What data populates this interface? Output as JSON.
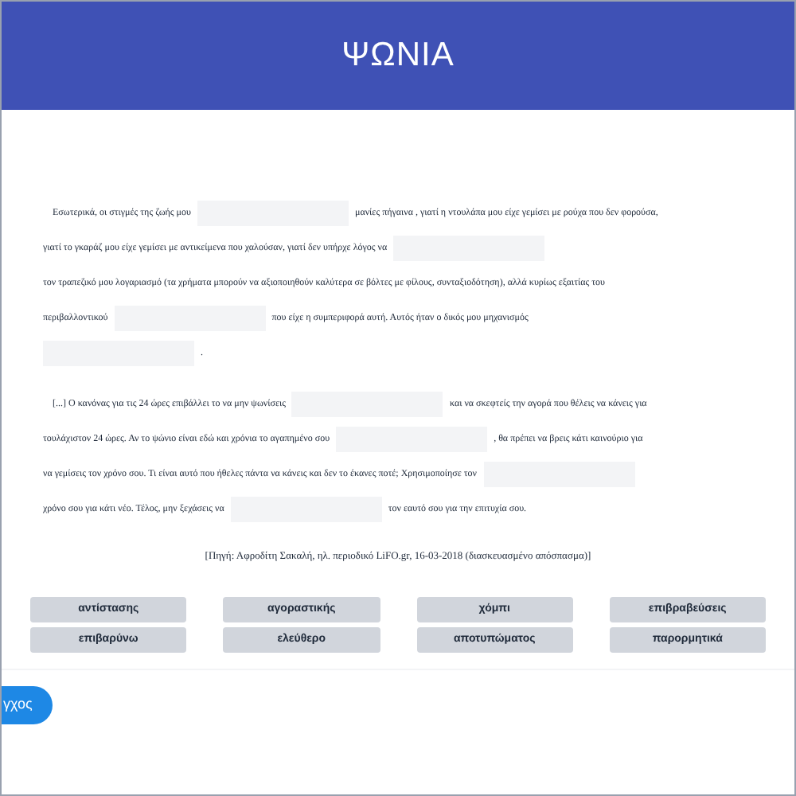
{
  "header": {
    "title": "ΨΩΝΙΑ"
  },
  "paragraphs": [
    {
      "lines": [
        [
          {
            "kind": "text",
            "text": "Εσωτερικά, οι στιγμές της ζωής μου"
          },
          {
            "kind": "blank"
          },
          {
            "kind": "text",
            "text": "μανίες πήγαινα , γιατί η ντουλάπα μου είχε γεμίσει με ρούχα που δεν φορούσα,"
          }
        ],
        [
          {
            "kind": "text",
            "text": "γιατί το γκαράζ μου είχε γεμίσει με αντικείμενα που χαλούσαν, γιατί δεν υπήρχε λόγος να"
          },
          {
            "kind": "blank"
          }
        ],
        [
          {
            "kind": "text",
            "text": "τον τραπεζικό μου λογαριασμό (τα χρήματα μπορούν να αξιοποιηθούν καλύτερα σε βόλτες με φίλους, συνταξιοδότηση), αλλά κυρίως εξαιτίας του"
          }
        ],
        [
          {
            "kind": "text",
            "text": "περιβαλλοντικού"
          },
          {
            "kind": "blank"
          },
          {
            "kind": "text",
            "text": "που είχε η συμπεριφορά αυτή. Αυτός ήταν ο δικός μου μηχανισμός"
          }
        ],
        [
          {
            "kind": "blank"
          },
          {
            "kind": "text",
            "text": "."
          }
        ]
      ]
    },
    {
      "lines": [
        [
          {
            "kind": "text",
            "text": "[...] Ο κανόνας για τις 24 ώρες επιβάλλει το να μην ψωνίσεις"
          },
          {
            "kind": "blank"
          },
          {
            "kind": "text",
            "text": "και να σκεφτείς την αγορά που θέλεις να κάνεις για"
          }
        ],
        [
          {
            "kind": "text",
            "text": "τουλάχιστον 24 ώρες. Αν το ψώνιο είναι εδώ και χρόνια το αγαπημένο σου"
          },
          {
            "kind": "blank"
          },
          {
            "kind": "text",
            "text": ", θα πρέπει να βρεις κάτι καινούριο για"
          }
        ],
        [
          {
            "kind": "text",
            "text": "να γεμίσεις τον χρόνο σου. Τι είναι αυτό που ήθελες πάντα να κάνεις και δεν το έκανες ποτέ; Χρησιμοποίησε τον"
          },
          {
            "kind": "blank"
          }
        ],
        [
          {
            "kind": "text",
            "text": "χρόνο σου για κάτι νέο. Τέλος, μην ξεχάσεις να"
          },
          {
            "kind": "blank"
          },
          {
            "kind": "text",
            "text": "τον εαυτό σου για την επιτυχία σου."
          }
        ]
      ]
    }
  ],
  "source": "[Πηγή: Αφροδίτη Σακαλή, ηλ. περιοδικό LiFO.gr,  16-03-2018 (διασκευασμένο απόσπασμα)]",
  "word_bank": [
    "αντίστασης",
    "αγοραστικής",
    "χόμπι",
    "επιβραβεύσεις",
    "επιβαρύνω",
    "ελεύθερο",
    "αποτυπώματος",
    "παρορμητικά"
  ],
  "check_button": {
    "label": "γχος"
  }
}
